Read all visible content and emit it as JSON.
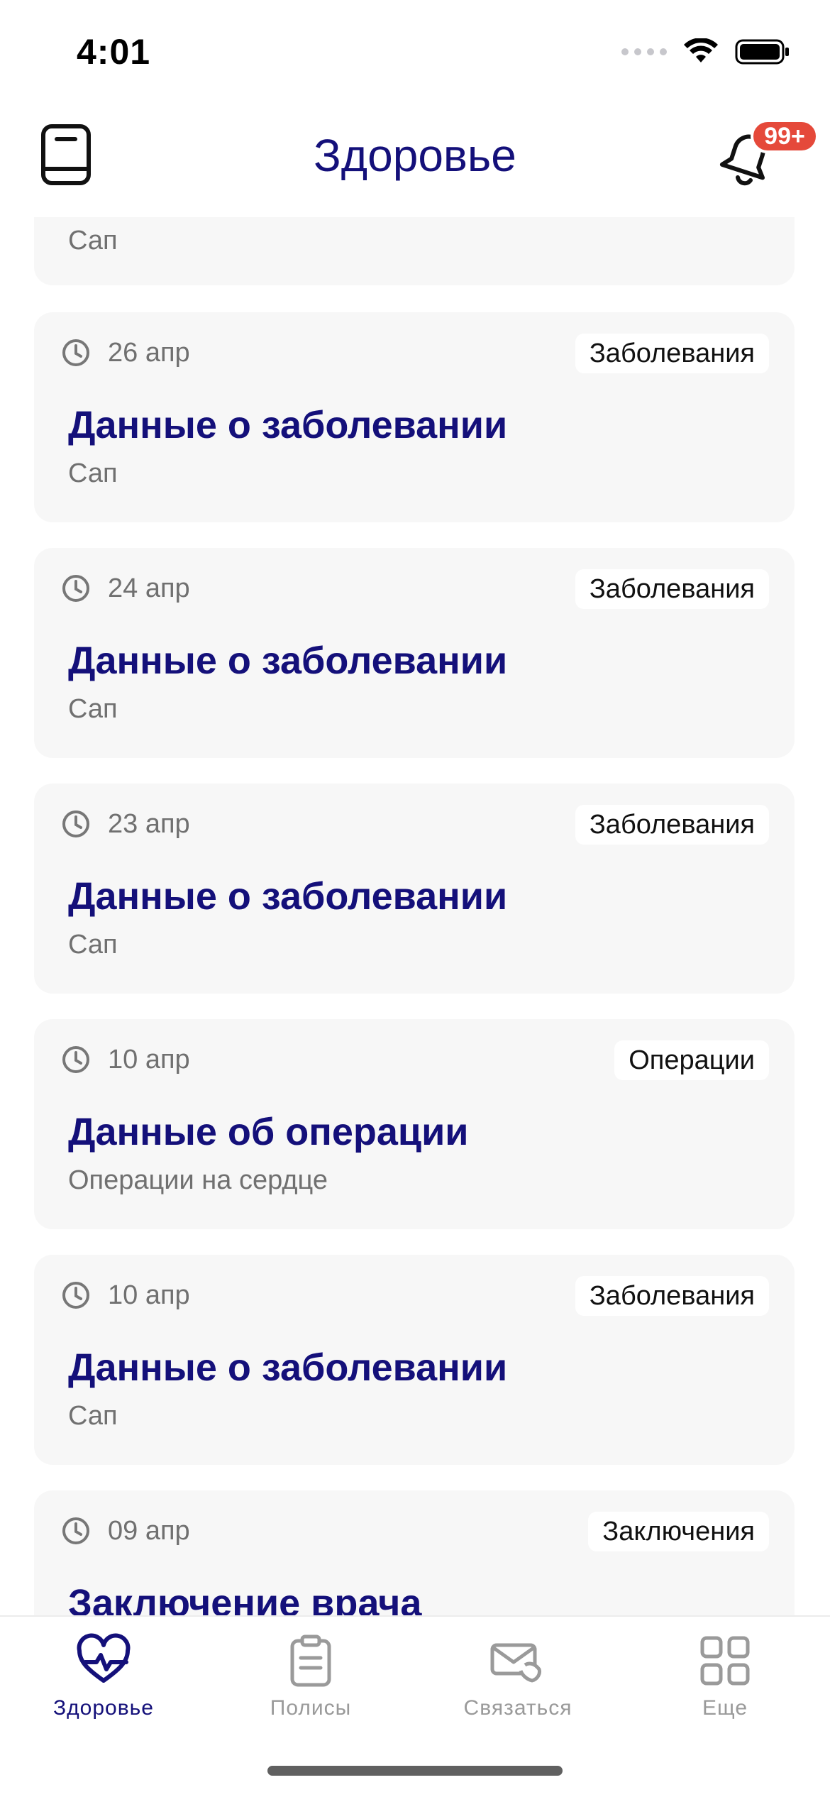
{
  "status_bar": {
    "time": "4:01"
  },
  "header": {
    "title": "Здоровье",
    "notification_badge": "99+"
  },
  "cards": [
    {
      "date": "",
      "tag": "",
      "title": "",
      "subtitle": "Сап"
    },
    {
      "date": "26 апр",
      "tag": "Заболевания",
      "title": "Данные о заболевании",
      "subtitle": "Сап"
    },
    {
      "date": "24 апр",
      "tag": "Заболевания",
      "title": "Данные о заболевании",
      "subtitle": "Сап"
    },
    {
      "date": "23 апр",
      "tag": "Заболевания",
      "title": "Данные о заболевании",
      "subtitle": "Сап"
    },
    {
      "date": "10 апр",
      "tag": "Операции",
      "title": "Данные об операции",
      "subtitle": "Операции на сердце"
    },
    {
      "date": "10 апр",
      "tag": "Заболевания",
      "title": "Данные о заболевании",
      "subtitle": "Сап"
    },
    {
      "date": "09 апр",
      "tag": "Заключения",
      "title": "Заключение врача",
      "subtitle": ""
    }
  ],
  "tabbar": {
    "items": [
      {
        "label": "Здоровье",
        "icon": "heart-pulse-icon",
        "active": true
      },
      {
        "label": "Полисы",
        "icon": "clipboard-icon",
        "active": false
      },
      {
        "label": "Связаться",
        "icon": "envelope-phone-icon",
        "active": false
      },
      {
        "label": "Еще",
        "icon": "grid-icon",
        "active": false
      }
    ]
  },
  "colors": {
    "accent": "#14107a",
    "badge": "#e5493a",
    "card_bg": "#f7f7f7",
    "muted": "#707070"
  }
}
